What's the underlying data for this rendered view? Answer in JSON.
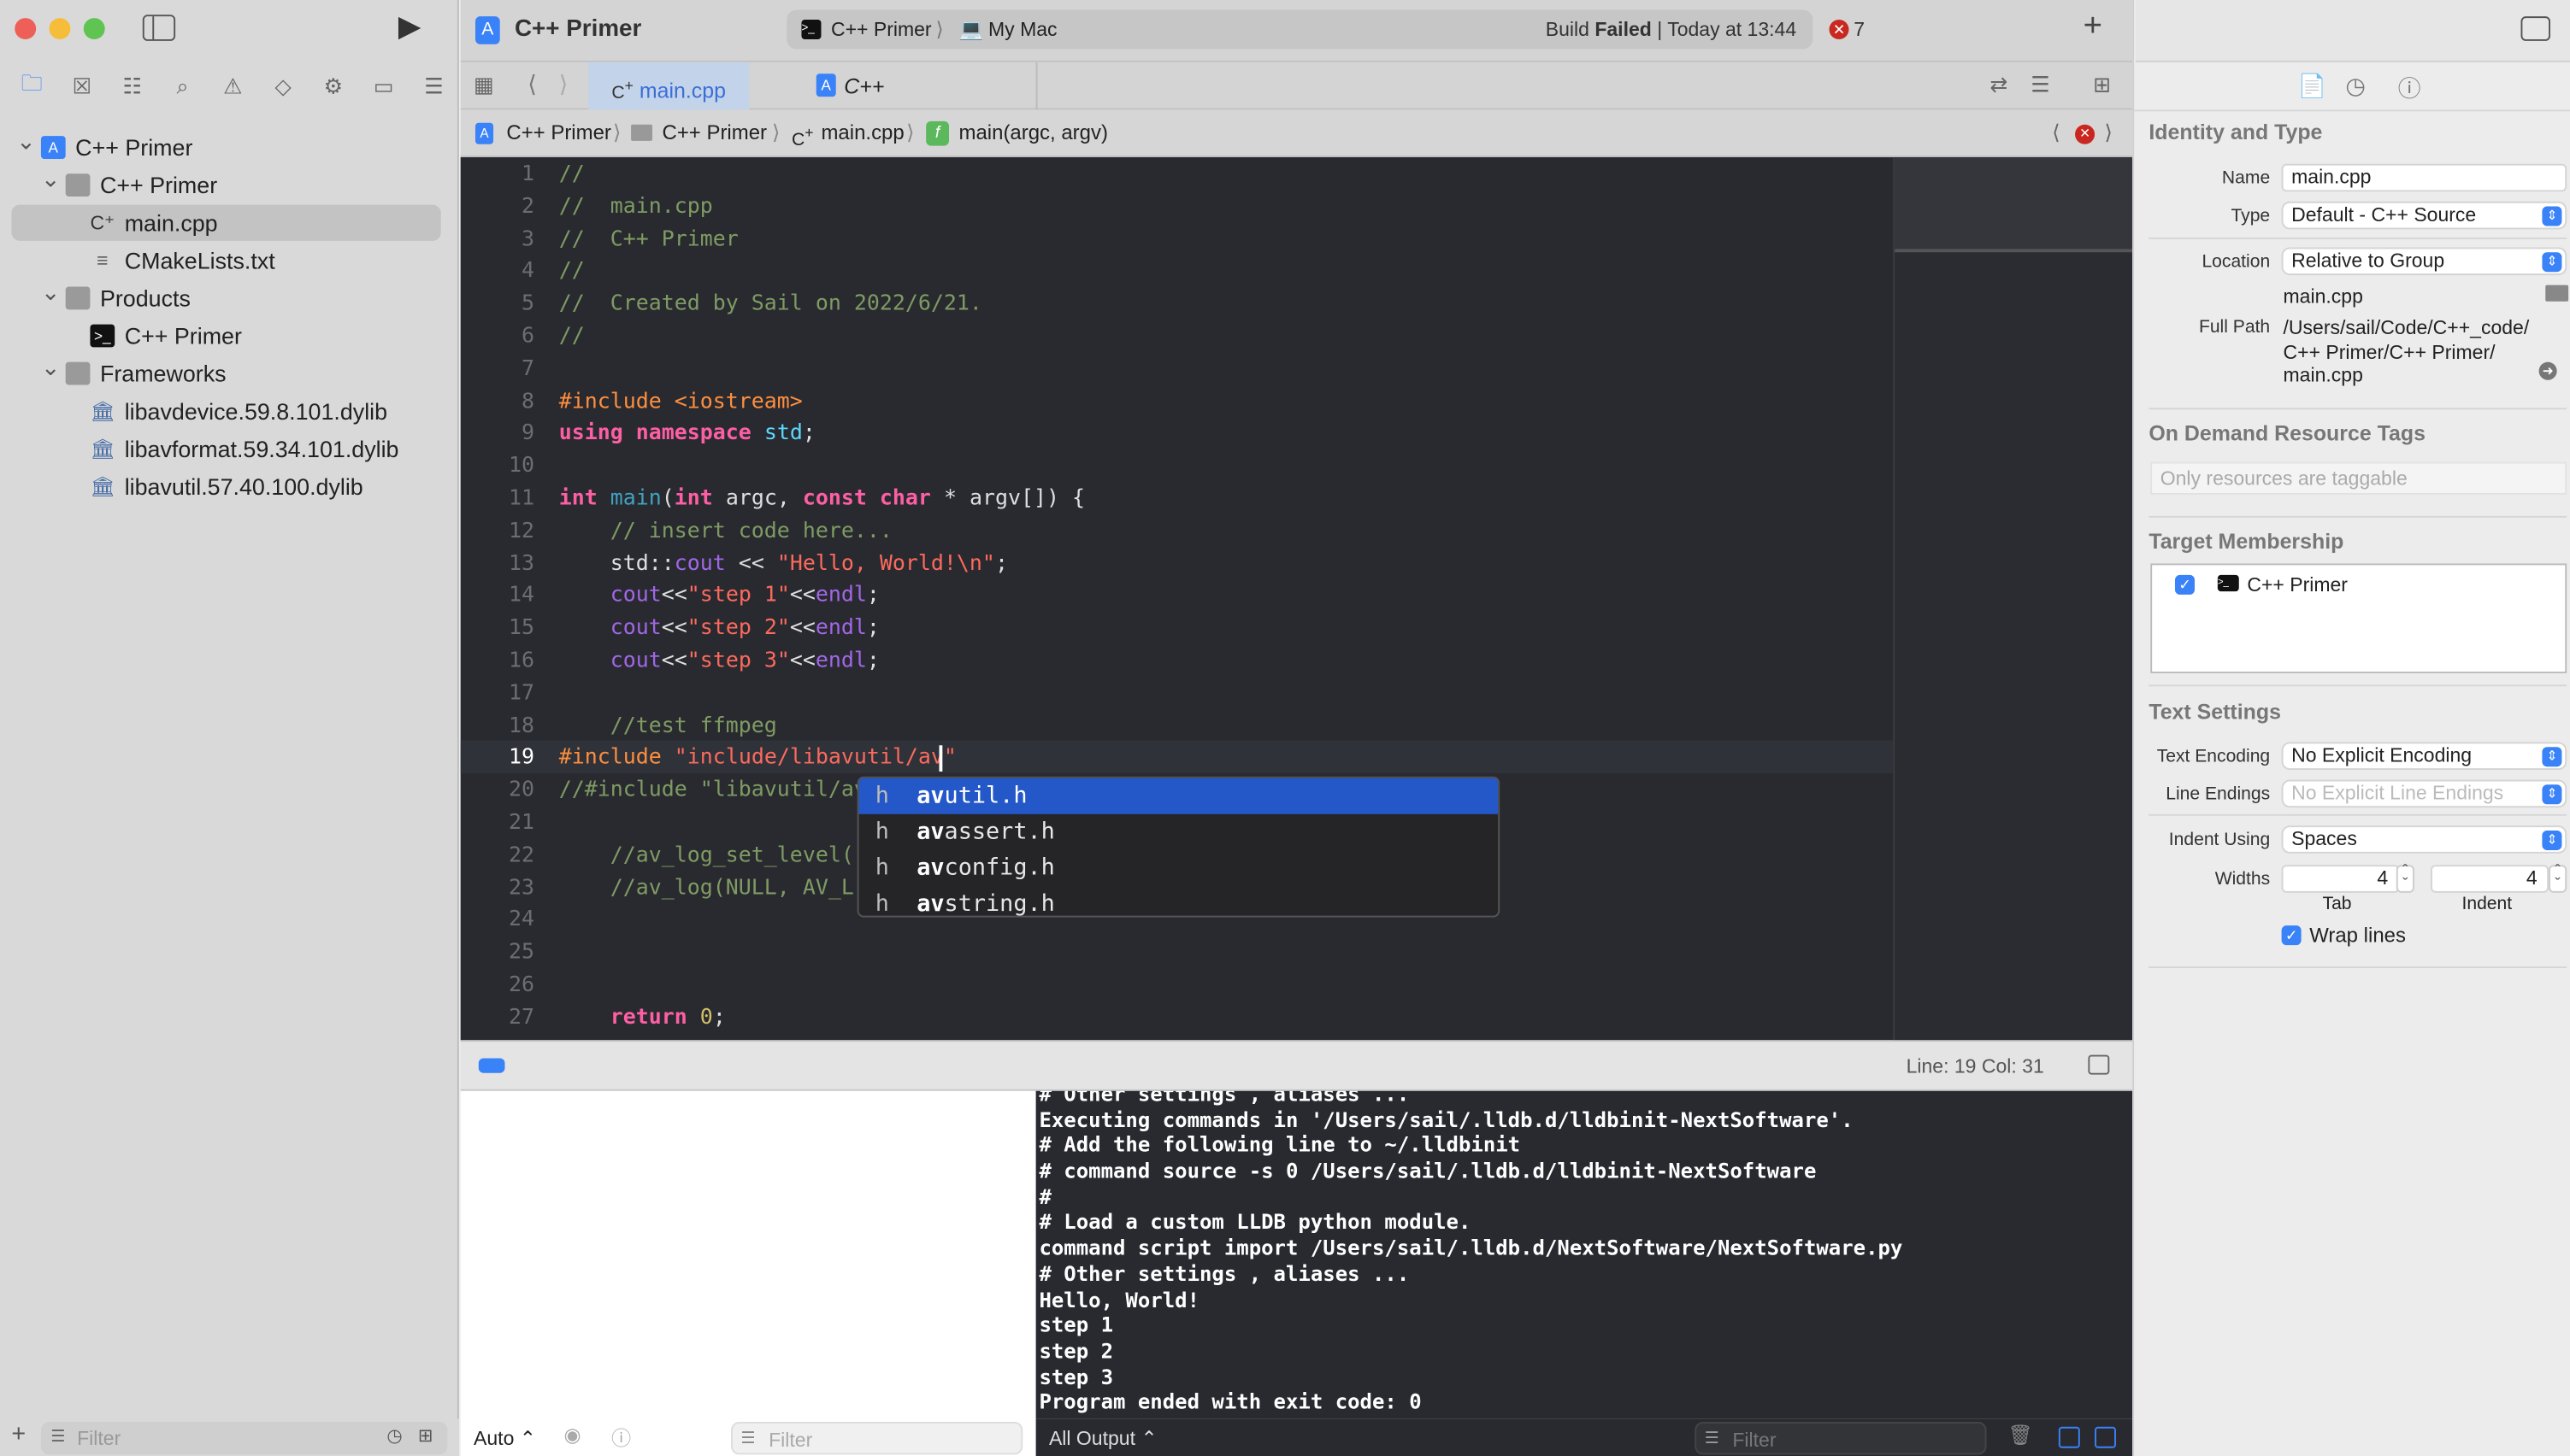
{
  "window": {
    "title": "C++ Primer"
  },
  "toolbar": {
    "scheme": "C++ Primer",
    "destination": "My Mac",
    "status_prefix": "Build",
    "status_bold": "Failed",
    "status_time": "Today at 13:44",
    "error_count": "7",
    "add_label": "+"
  },
  "navigator": {
    "icons": [
      "folder-icon",
      "source-control-icon",
      "symbol-icon",
      "search-icon",
      "issue-icon",
      "test-icon",
      "debug-icon",
      "breakpoint-icon",
      "report-icon"
    ],
    "items": [
      {
        "label": "C++ Primer",
        "level": 0,
        "type": "project",
        "expanded": true
      },
      {
        "label": "C++ Primer",
        "level": 1,
        "type": "folder",
        "expanded": true
      },
      {
        "label": "main.cpp",
        "level": 2,
        "type": "cpp",
        "selected": true
      },
      {
        "label": "CMakeLists.txt",
        "level": 2,
        "type": "text"
      },
      {
        "label": "Products",
        "level": 1,
        "type": "folder",
        "expanded": true
      },
      {
        "label": "C++ Primer",
        "level": 2,
        "type": "exec"
      },
      {
        "label": "Frameworks",
        "level": 1,
        "type": "folder",
        "expanded": true
      },
      {
        "label": "libavdevice.59.8.101.dylib",
        "level": 2,
        "type": "lib"
      },
      {
        "label": "libavformat.59.34.101.dylib",
        "level": 2,
        "type": "lib"
      },
      {
        "label": "libavutil.57.40.100.dylib",
        "level": 2,
        "type": "lib"
      }
    ],
    "filter_placeholder": "Filter"
  },
  "tabs": [
    {
      "label": "main.cpp",
      "active": true
    },
    {
      "label": "C++ Primer.xcodeproj",
      "active": false
    }
  ],
  "jumpbar": [
    "C++ Primer",
    "C++ Primer",
    "main.cpp",
    "main(argc, argv)"
  ],
  "editor": {
    "current_line": 19,
    "lines": [
      [
        [
          "//",
          "cm"
        ]
      ],
      [
        [
          "//  main.cpp",
          "cm"
        ]
      ],
      [
        [
          "//  C++ Primer",
          "cm"
        ]
      ],
      [
        [
          "//",
          "cm"
        ]
      ],
      [
        [
          "//  Created by Sail on 2022/6/21.",
          "cm"
        ]
      ],
      [
        [
          "//",
          "cm"
        ]
      ],
      [],
      [
        [
          "#include <iostream>",
          "pp"
        ]
      ],
      [
        [
          "using",
          "kw"
        ],
        [
          " ",
          "pl"
        ],
        [
          "namespace",
          "kw"
        ],
        [
          " ",
          "pl"
        ],
        [
          "std",
          "ty"
        ],
        [
          ";",
          "pl"
        ]
      ],
      [],
      [
        [
          "int",
          "kw"
        ],
        [
          " ",
          "pl"
        ],
        [
          "main",
          "fn"
        ],
        [
          "(",
          "pl"
        ],
        [
          "int",
          "kw"
        ],
        [
          " argc, ",
          "pl"
        ],
        [
          "const",
          "kw"
        ],
        [
          " ",
          "pl"
        ],
        [
          "char",
          "kw"
        ],
        [
          " * argv[]) {",
          "pl"
        ]
      ],
      [
        [
          "    // insert code here...",
          "cm"
        ]
      ],
      [
        [
          "    std::",
          "pl"
        ],
        [
          "cout",
          "pu"
        ],
        [
          " << ",
          "pl"
        ],
        [
          "\"Hello, World!\\n\"",
          "st"
        ],
        [
          ";",
          "pl"
        ]
      ],
      [
        [
          "    ",
          "pl"
        ],
        [
          "cout",
          "pu"
        ],
        [
          "<<",
          "pl"
        ],
        [
          "\"step 1\"",
          "st"
        ],
        [
          "<<",
          "pl"
        ],
        [
          "endl",
          "pu"
        ],
        [
          ";",
          "pl"
        ]
      ],
      [
        [
          "    ",
          "pl"
        ],
        [
          "cout",
          "pu"
        ],
        [
          "<<",
          "pl"
        ],
        [
          "\"step 2\"",
          "st"
        ],
        [
          "<<",
          "pl"
        ],
        [
          "endl",
          "pu"
        ],
        [
          ";",
          "pl"
        ]
      ],
      [
        [
          "    ",
          "pl"
        ],
        [
          "cout",
          "pu"
        ],
        [
          "<<",
          "pl"
        ],
        [
          "\"step 3\"",
          "st"
        ],
        [
          "<<",
          "pl"
        ],
        [
          "endl",
          "pu"
        ],
        [
          ";",
          "pl"
        ]
      ],
      [],
      [
        [
          "    //test ffmpeg",
          "cm"
        ]
      ],
      [
        [
          "#include ",
          "pp"
        ],
        [
          "\"include/libavutil/av\"",
          "st"
        ]
      ],
      [
        [
          "//#include \"libavutil/av",
          "cm"
        ]
      ],
      [],
      [
        [
          "    //av_log_set_level(",
          "cm"
        ]
      ],
      [
        [
          "    //av_log(NULL, AV_L",
          "cm"
        ]
      ],
      [],
      [],
      [],
      [
        [
          "    ",
          "pl"
        ],
        [
          "return",
          "kw"
        ],
        [
          " ",
          "pl"
        ],
        [
          "0",
          "nu"
        ],
        [
          ";",
          "pl"
        ]
      ]
    ],
    "completions": [
      {
        "kind": "h",
        "match": "av",
        "rest": "util.h"
      },
      {
        "kind": "h",
        "match": "av",
        "rest": "assert.h"
      },
      {
        "kind": "h",
        "match": "av",
        "rest": "config.h"
      },
      {
        "kind": "h",
        "match": "av",
        "rest": "string.h"
      }
    ]
  },
  "debugbar": {
    "position": "Line: 19  Col: 31"
  },
  "console": {
    "lines": [
      "# Other settings , aliases ...",
      "Executing commands in '/Users/sail/.lldb.d/lldbinit-NextSoftware'.",
      "# Add the following line to ~/.lldbinit",
      "# command source -s 0 /Users/sail/.lldb.d/lldbinit-NextSoftware",
      "#",
      "# Load a custom LLDB python module.",
      "command script import /Users/sail/.lldb.d/NextSoftware/NextSoftware.py",
      "# Other settings , aliases ...",
      "Hello, World!",
      "step 1",
      "step 2",
      "step 3",
      "Program ended with exit code: 0"
    ],
    "output_select": "All Output ⌃",
    "filter_placeholder": "Filter"
  },
  "variables": {
    "scope_select": "Auto ⌃",
    "filter_placeholder": "Filter"
  },
  "inspector": {
    "identity": {
      "title": "Identity and Type",
      "name_label": "Name",
      "name_value": "main.cpp",
      "type_label": "Type",
      "type_value": "Default - C++ Source",
      "location_label": "Location",
      "location_value": "Relative to Group",
      "location_file": "main.cpp",
      "fullpath_label": "Full Path",
      "fullpath_lines": [
        "/Users/sail/Code/C++_code/",
        "C++ Primer/C++ Primer/",
        "main.cpp"
      ]
    },
    "odr": {
      "title": "On Demand Resource Tags",
      "placeholder": "Only resources are taggable"
    },
    "target": {
      "title": "Target Membership",
      "items": [
        {
          "label": "C++ Primer",
          "checked": true
        }
      ]
    },
    "text": {
      "title": "Text Settings",
      "encoding_label": "Text Encoding",
      "encoding_value": "No Explicit Encoding",
      "endings_label": "Line Endings",
      "endings_value": "No Explicit Line Endings",
      "indent_label": "Indent Using",
      "indent_value": "Spaces",
      "widths_label": "Widths",
      "tab_value": "4",
      "tab_label": "Tab",
      "indent_width_value": "4",
      "indent_width_label": "Indent",
      "wrap_label": "Wrap lines",
      "wrap_checked": true
    }
  },
  "colors": {
    "accent": "#3a82f7",
    "selection": "#2458c8",
    "error": "#c9271f",
    "editor_bg": "#292a30"
  }
}
